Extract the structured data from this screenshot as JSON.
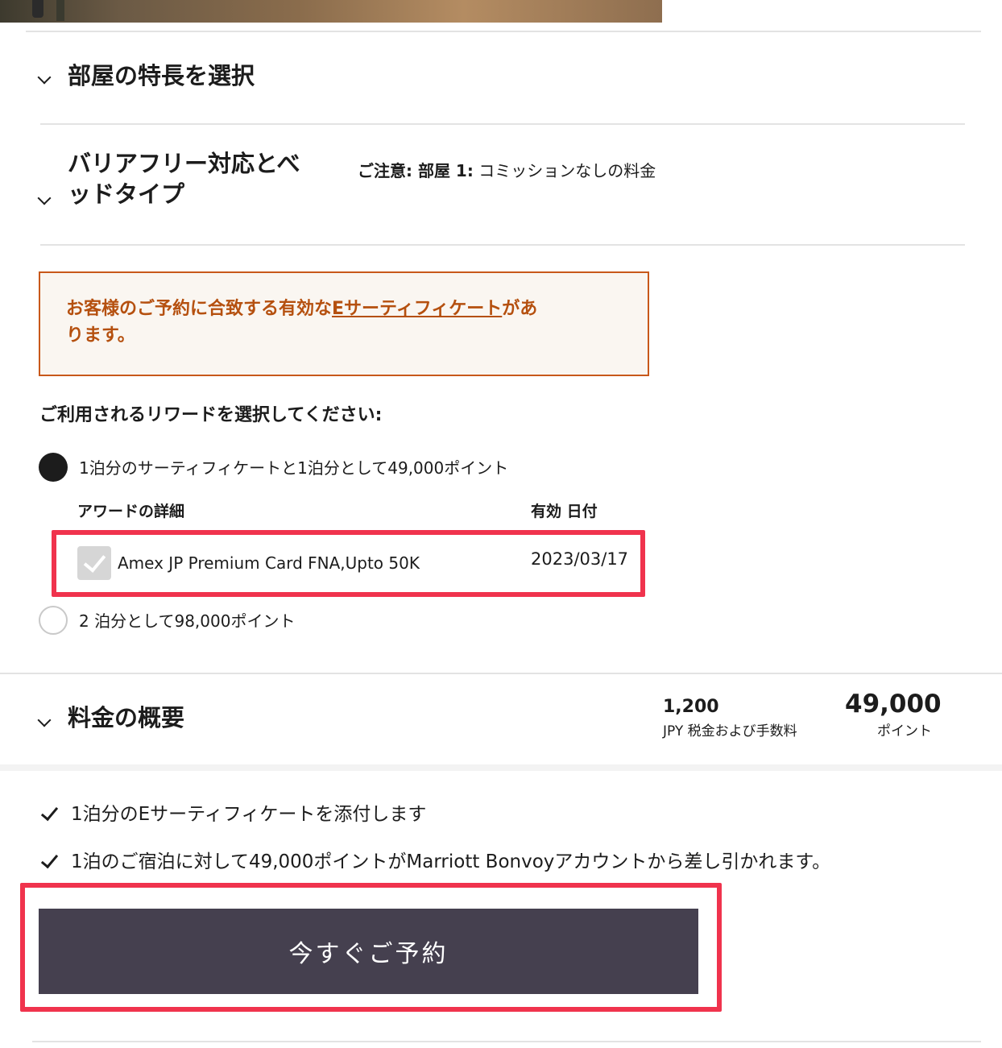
{
  "sections": {
    "room_features": {
      "title": "部屋の特長を選択"
    },
    "accessibility": {
      "title_line1": "バリアフリー対応とべ",
      "title_line2": "ッドタイプ",
      "notice_prefix": "ご注意: 部屋 1:",
      "notice_text": " コミッションなしの料金"
    }
  },
  "alert": {
    "text_before": "お客様のご予約に合致する有効な",
    "link_text": "Eサーティフィケート",
    "text_after_line1": "があ",
    "text_line2": "ります。"
  },
  "rewards": {
    "question": "ご利用されるリワードを選択してください:",
    "option1_label": "1泊分のサーティフィケートと1泊分として49,000ポイント",
    "award_details_header": "アワードの詳細",
    "valid_date_header": "有効 日付",
    "certificate": {
      "name": "Amex JP Premium Card FNA,Upto 50K",
      "date": "2023/03/17",
      "checked": true
    },
    "option2_label": "2 泊分として98,000ポイント",
    "selected_option": 1
  },
  "summary": {
    "title": "料金の概要",
    "taxes_amount": "1,200",
    "taxes_label": "JPY 税金および手数料",
    "points_amount": "49,000",
    "points_label": "ポイント"
  },
  "confirmations": [
    "1泊分のEサーティフィケートを添付します",
    "1泊のご宿泊に対して49,000ポイントがMarriott Bonvoyアカウントから差し引かれます。"
  ],
  "book_button": {
    "label": "今すぐご予約"
  },
  "colors": {
    "alert_border": "#c8581a",
    "alert_text": "#b5500f",
    "highlight": "#f0334d",
    "button_bg": "#45404f"
  }
}
